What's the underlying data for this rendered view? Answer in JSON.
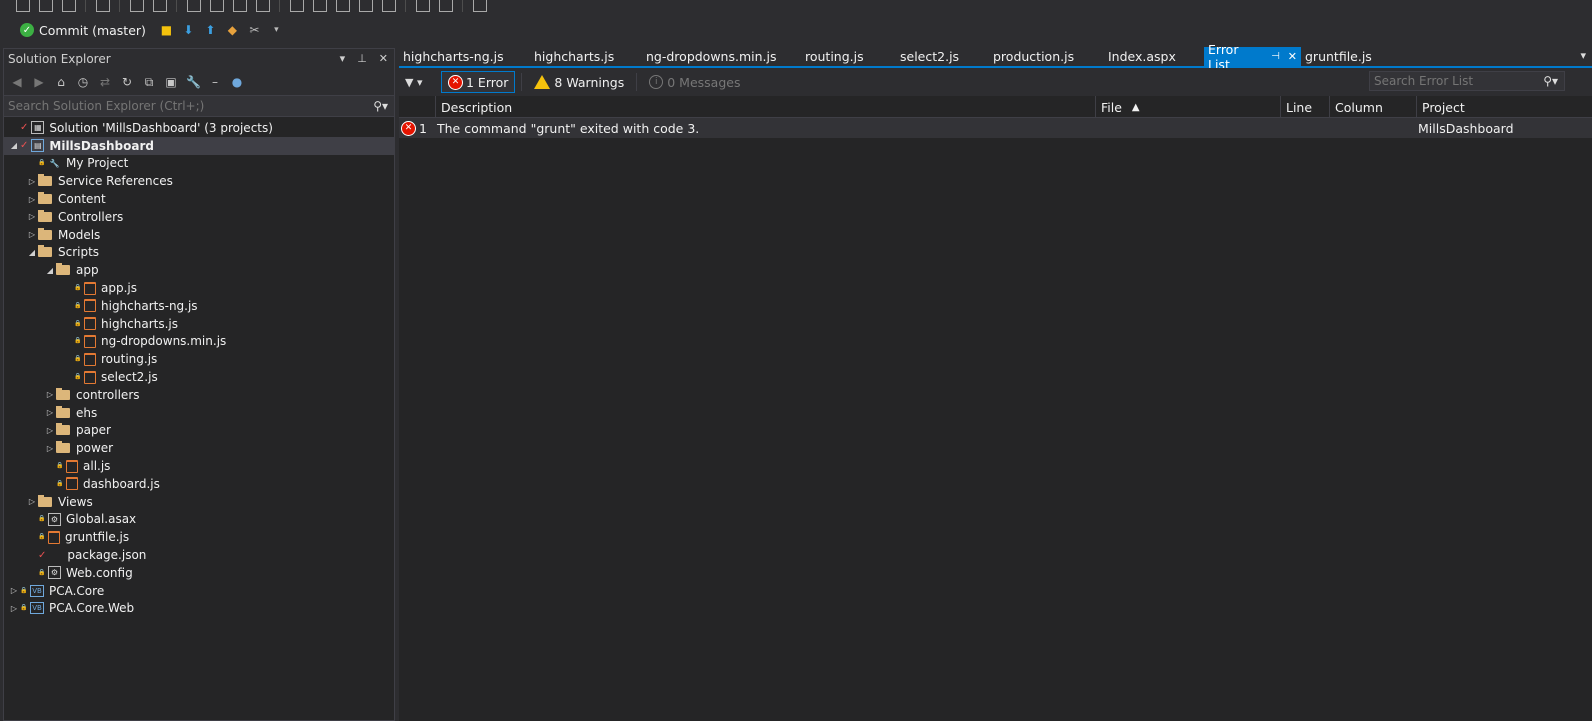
{
  "toolbar": {
    "commit_label": "Commit (master)"
  },
  "solution_explorer": {
    "title": "Solution Explorer",
    "search_placeholder": "Search Solution Explorer (Ctrl+;)",
    "tree": [
      {
        "label": "Solution 'MillsDashboard' (3 projects)",
        "level": 0,
        "kind": "solution"
      },
      {
        "label": "MillsDashboard",
        "level": 0,
        "kind": "project",
        "selected": true
      },
      {
        "label": "My Project",
        "level": 1,
        "kind": "wrench"
      },
      {
        "label": "Service References",
        "level": 1,
        "kind": "folder"
      },
      {
        "label": "Content",
        "level": 1,
        "kind": "folder"
      },
      {
        "label": "Controllers",
        "level": 1,
        "kind": "folder"
      },
      {
        "label": "Models",
        "level": 1,
        "kind": "folder"
      },
      {
        "label": "Scripts",
        "level": 1,
        "kind": "folder-open"
      },
      {
        "label": "app",
        "level": 2,
        "kind": "folder-open"
      },
      {
        "label": "app.js",
        "level": 3,
        "kind": "js"
      },
      {
        "label": "highcharts-ng.js",
        "level": 3,
        "kind": "js"
      },
      {
        "label": "highcharts.js",
        "level": 3,
        "kind": "js"
      },
      {
        "label": "ng-dropdowns.min.js",
        "level": 3,
        "kind": "js"
      },
      {
        "label": "routing.js",
        "level": 3,
        "kind": "js"
      },
      {
        "label": "select2.js",
        "level": 3,
        "kind": "js"
      },
      {
        "label": "controllers",
        "level": 2,
        "kind": "folder"
      },
      {
        "label": "ehs",
        "level": 2,
        "kind": "folder"
      },
      {
        "label": "paper",
        "level": 2,
        "kind": "folder"
      },
      {
        "label": "power",
        "level": 2,
        "kind": "folder"
      },
      {
        "label": "all.js",
        "level": 2,
        "kind": "js"
      },
      {
        "label": "dashboard.js",
        "level": 2,
        "kind": "js"
      },
      {
        "label": "Views",
        "level": 1,
        "kind": "folder"
      },
      {
        "label": "Global.asax",
        "level": 1,
        "kind": "gen"
      },
      {
        "label": "gruntfile.js",
        "level": 1,
        "kind": "js"
      },
      {
        "label": "package.json",
        "level": 1,
        "kind": "json"
      },
      {
        "label": "Web.config",
        "level": 1,
        "kind": "gen"
      },
      {
        "label": "PCA.Core",
        "level": 0,
        "kind": "vb"
      },
      {
        "label": "PCA.Core.Web",
        "level": 0,
        "kind": "vb"
      }
    ]
  },
  "tabs": [
    {
      "label": "highcharts-ng.js",
      "active": false
    },
    {
      "label": "highcharts.js",
      "active": false
    },
    {
      "label": "ng-dropdowns.min.js",
      "active": false
    },
    {
      "label": "routing.js",
      "active": false
    },
    {
      "label": "select2.js",
      "active": false
    },
    {
      "label": "production.js",
      "active": false
    },
    {
      "label": "Index.aspx",
      "active": false
    },
    {
      "label": "Error List",
      "active": true
    },
    {
      "label": "gruntfile.js",
      "active": false
    }
  ],
  "error_list": {
    "errors_label": "1 Error",
    "warnings_label": "8 Warnings",
    "messages_label": "0 Messages",
    "search_placeholder": "Search Error List",
    "columns": {
      "description": "Description",
      "file": "File",
      "line": "Line",
      "column": "Column",
      "project": "Project"
    },
    "rows": [
      {
        "num": "1",
        "description": "The command \"grunt\" exited with code 3.",
        "file": "",
        "line": "",
        "column": "",
        "project": "MillsDashboard"
      }
    ]
  },
  "colors": {
    "accent": "#007acc",
    "bg": "#2d2d30",
    "panel": "#252526",
    "error": "#e51400",
    "warning": "#f4c20d",
    "folder": "#dcb67a",
    "js": "#e37933"
  }
}
